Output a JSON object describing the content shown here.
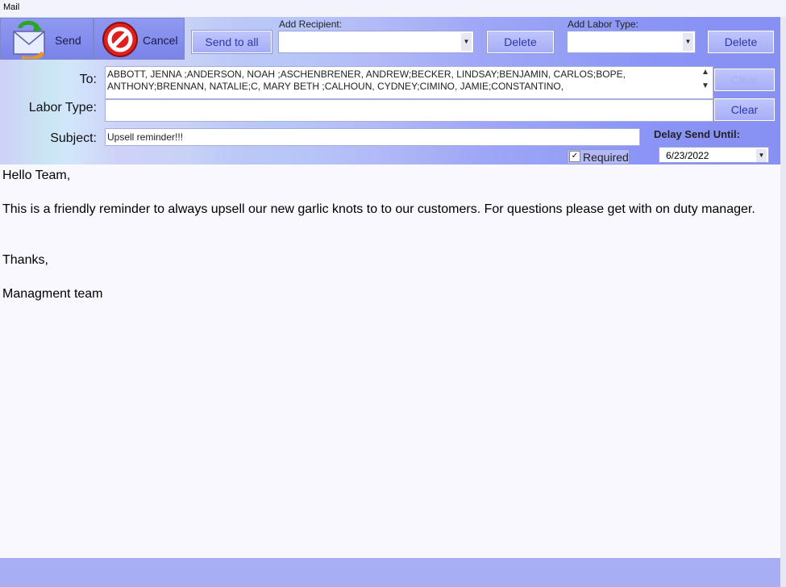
{
  "window": {
    "title": "Mail"
  },
  "toolbar": {
    "send_label": "Send",
    "cancel_label": "Cancel",
    "send_to_all_label": "Send to all",
    "add_recipient_label": "Add Recipient:",
    "add_recipient_value": "",
    "delete_recipient_label": "Delete",
    "add_labor_type_label": "Add Labor Type:",
    "add_labor_type_value": "",
    "delete_labor_type_label": "Delete",
    "clear_to_label": "Clear",
    "clear_labor_label": "Clear"
  },
  "form": {
    "to_label": "To:",
    "to_value": "ABBOTT, JENNA ;ANDERSON, NOAH ;ASCHENBRENER, ANDREW;BECKER, LINDSAY;BENJAMIN, CARLOS;BOPE, ANTHONY;BRENNAN, NATALIE;C, MARY BETH ;CALHOUN, CYDNEY;CIMINO, JAMIE;CONSTANTINO,",
    "labor_type_label": "Labor Type:",
    "labor_type_value": "",
    "subject_label": "Subject:",
    "subject_value": "Upsell reminder!!!",
    "required_label": "Required",
    "required_checked": true,
    "delay_send_label": "Delay Send Until:",
    "delay_send_date": "6/23/2022"
  },
  "message": {
    "lines": [
      "Hello Team,",
      "This is a friendly reminder to always upsell our new garlic knots to to our customers. For questions please get with on duty manager.",
      "Thanks,",
      "Managment team"
    ]
  },
  "colors": {
    "accent": "#8790f3",
    "button_text": "#2d37a8",
    "cancel_red": "#e02020"
  },
  "icons": [
    "send-mail-icon",
    "cancel-icon",
    "chevron-down-icon",
    "checkmark-icon"
  ]
}
